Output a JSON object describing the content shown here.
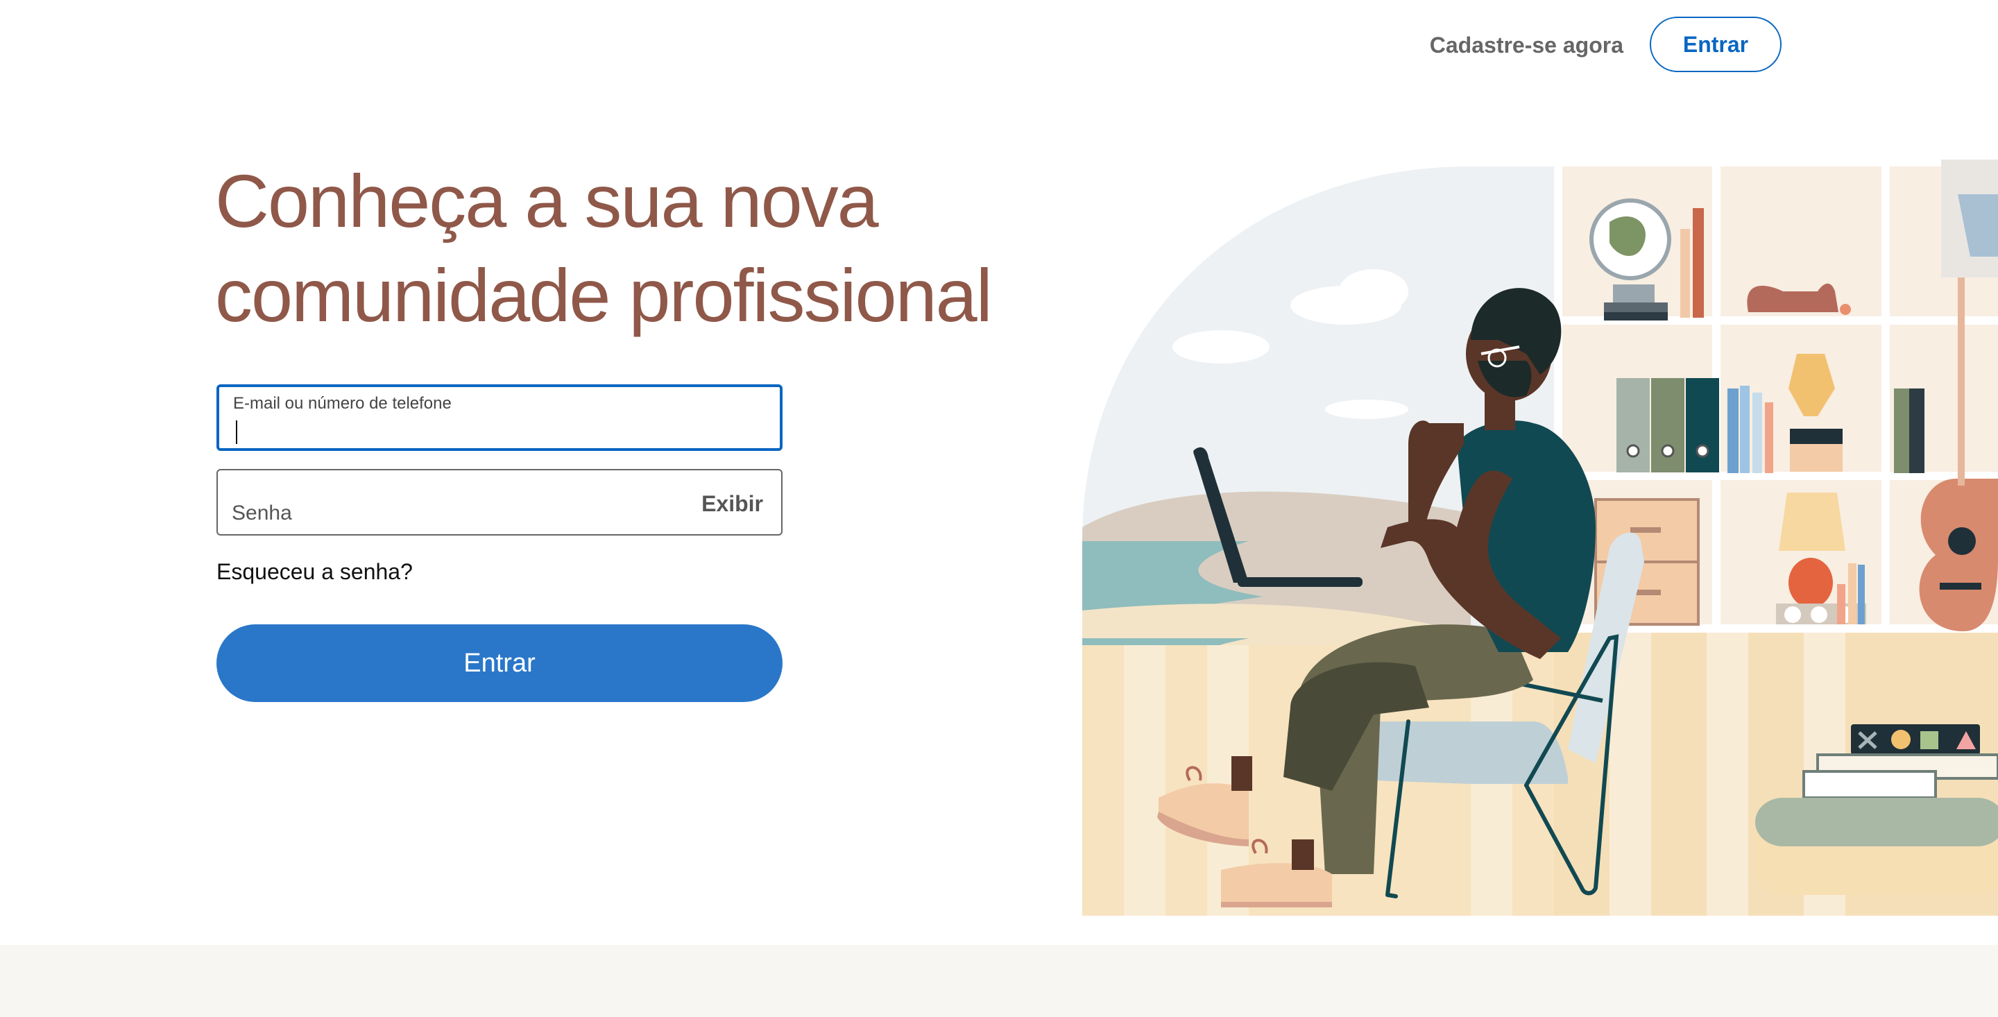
{
  "header": {
    "signup_label": "Cadastre-se agora",
    "signin_label": "Entrar"
  },
  "hero": {
    "headline_line1": "Conheça a sua nova",
    "headline_line2": "comunidade profissional"
  },
  "form": {
    "email_label": "E-mail ou número de telefone",
    "email_value": "",
    "password_placeholder": "Senha",
    "show_password_label": "Exibir",
    "forgot_password_label": "Esqueceu a senha?",
    "submit_label": "Entrar"
  },
  "colors": {
    "brand_blue": "#0a66c2",
    "button_blue": "#2a77c9",
    "headline_brown": "#8f5849"
  },
  "icons": {
    "illustration": "person-with-laptop-illustration"
  }
}
